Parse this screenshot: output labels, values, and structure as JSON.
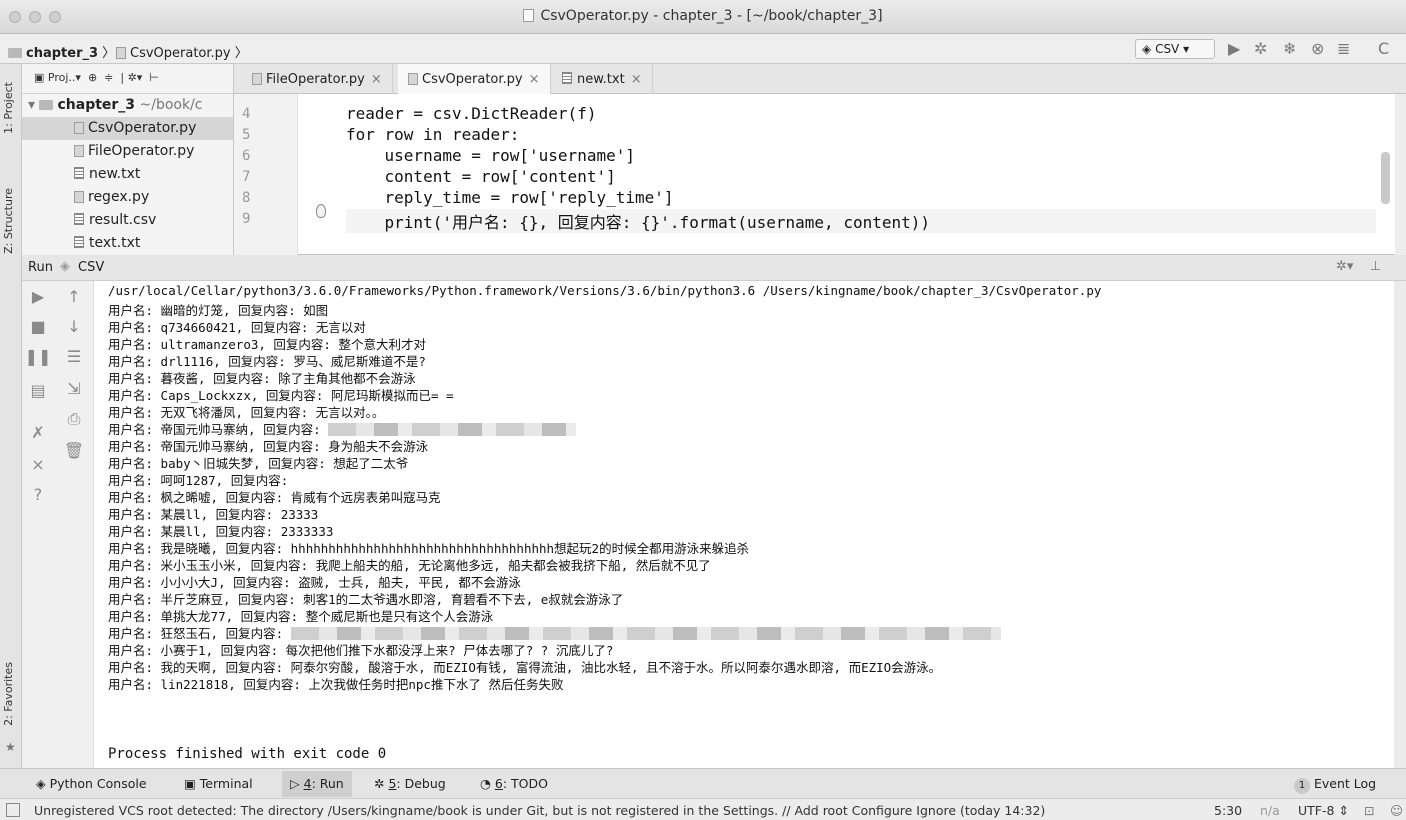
{
  "window": {
    "title": "CsvOperator.py - chapter_3 - [~/book/chapter_3]"
  },
  "navbar": {
    "breadcrumb": [
      "chapter_3",
      "CsvOperator.py"
    ],
    "run_config": "CSV"
  },
  "left_strip": {
    "tabs": [
      "1: Project",
      "Z: Structure",
      "2: Favorites"
    ]
  },
  "project": {
    "toolbar_label": "Proj..",
    "root": "chapter_3",
    "root_path": "~/book/c",
    "items": [
      "CsvOperator.py",
      "FileOperator.py",
      "new.txt",
      "regex.py",
      "result.csv",
      "text.txt"
    ]
  },
  "editor": {
    "tabs": [
      "FileOperator.py",
      "CsvOperator.py",
      "new.txt"
    ],
    "active_tab": "CsvOperator.py",
    "line_numbers": [
      "4",
      "5",
      "6",
      "7",
      "8",
      "9"
    ],
    "lines": [
      "reader = csv.DictReader(f)",
      "for row in reader:",
      "    username = row['username']",
      "    content = row['content']",
      "    reply_time = row['reply_time']",
      "    print('用户名: {}, 回复内容: {}'.format(username, content))"
    ]
  },
  "run": {
    "label": "Run",
    "config": "CSV",
    "output": [
      "/usr/local/Cellar/python3/3.6.0/Frameworks/Python.framework/Versions/3.6/bin/python3.6 /Users/kingname/book/chapter_3/CsvOperator.py",
      "用户名: 幽暗的灯笼, 回复内容: 如图",
      "用户名: q734660421, 回复内容: 无言以对",
      "用户名: ultramanzero3, 回复内容: 整个意大利才对",
      "用户名: drl1116, 回复内容: 罗马、威尼斯难道不是?",
      "用户名: 暮夜酱, 回复内容: 除了主角其他都不会游泳",
      "用户名: Caps_Lockxzx, 回复内容: 阿尼玛斯模拟而已= =",
      "用户名: 无双飞将潘凤, 回复内容: 无言以对。。",
      "用户名: 帝国元帅马寨纳, 回复内容: ",
      "用户名: 帝国元帅马寨纳, 回复内容: 身为船夫不会游泳",
      "用户名: baby丶旧城失梦, 回复内容: 想起了二太爷",
      "用户名: 呵呵1287, 回复内容: ",
      "用户名: 枫之晞嘘, 回复内容: 肯威有个远房表弟叫寇马克",
      "用户名: 某晨ll, 回复内容: 23333",
      "用户名: 某晨ll, 回复内容: 2333333",
      "用户名: 我是晓曦, 回复内容: hhhhhhhhhhhhhhhhhhhhhhhhhhhhhhhhhhh想起玩2的时候全都用游泳来躲追杀",
      "用户名: 米小玉玉小米, 回复内容: 我爬上船夫的船, 无论离他多远, 船夫都会被我挤下船, 然后就不见了",
      "用户名: 小小小大J, 回复内容: 盗贼, 士兵, 船夫, 平民, 都不会游泳",
      "用户名: 半斤芝麻豆, 回复内容: 刺客1的二太爷遇水即溶, 育碧看不下去, e叔就会游泳了",
      "用户名: 单挑大龙77, 回复内容: 整个威尼斯也是只有这个人会游泳",
      "用户名: 狂怒玉石, 回复内容: ",
      "用户名: 小赛于1, 回复内容: 每次把他们推下水都没浮上来? 尸体去哪了? ? 沉底儿了?",
      "用户名: 我的天啊, 回复内容: 阿泰尔穷酸, 酸溶于水, 而EZIO有钱, 富得流油, 油比水轻, 且不溶于水。所以阿泰尔遇水即溶, 而EZIO会游泳。",
      "用户名: lin221818, 回复内容: 上次我做任务时把npc推下水了 然后任务失败",
      "",
      "Process finished with exit code 0"
    ]
  },
  "bottom_tabs": {
    "python_console": "Python Console",
    "terminal": "Terminal",
    "run_num": "4",
    "run_label": ": Run",
    "debug_num": "5",
    "debug_label": ": Debug",
    "todo_num": "6",
    "todo_label": ": TODO",
    "event_log_count": "1",
    "event_log": "Event Log"
  },
  "status": {
    "message": "Unregistered VCS root detected: The directory /Users/kingname/book is under Git, but is not registered in the Settings. // Add root  Configure  Ignore (today 14:32)",
    "position": "5:30",
    "na": "n/a",
    "encoding": "UTF-8"
  }
}
